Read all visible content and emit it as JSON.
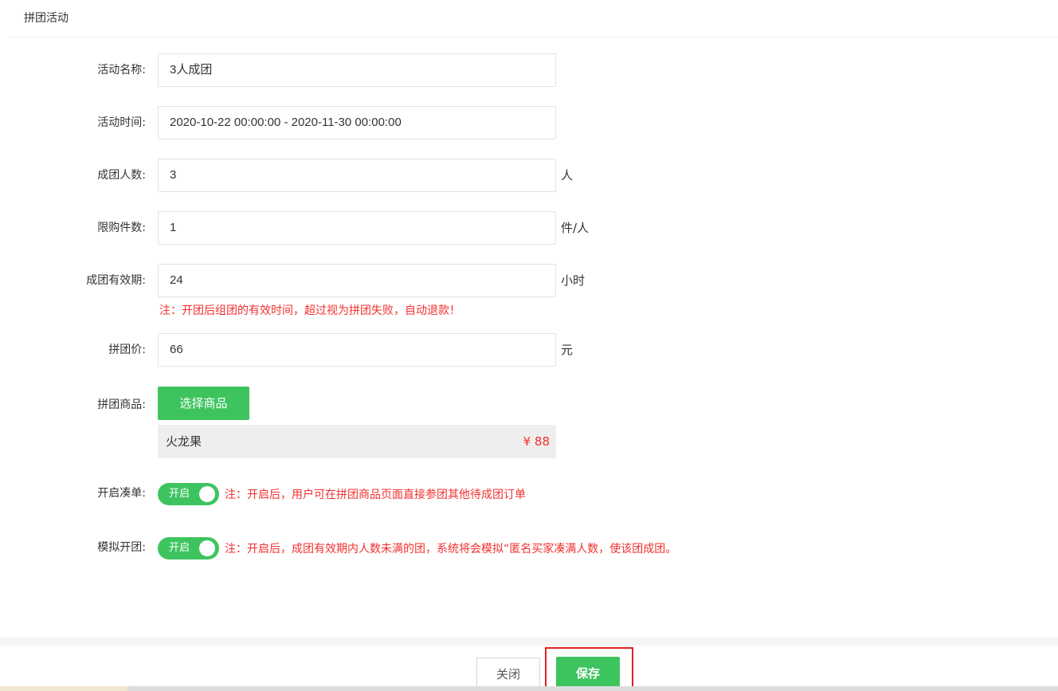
{
  "panel": {
    "title": "拼团活动"
  },
  "form": {
    "name": {
      "label": "活动名称:",
      "value": "3人成团"
    },
    "time": {
      "label": "活动时间:",
      "value": "2020-10-22 00:00:00 - 2020-11-30 00:00:00"
    },
    "group_size": {
      "label": "成团人数:",
      "value": "3",
      "unit": "人"
    },
    "limit": {
      "label": "限购件数:",
      "value": "1",
      "unit": "件/人"
    },
    "validity": {
      "label": "成团有效期:",
      "value": "24",
      "unit": "小时",
      "note": "注：开团后组团的有效时间，超过视为拼团失败，自动退款！"
    },
    "price": {
      "label": "拼团价:",
      "value": "66",
      "unit": "元"
    },
    "goods": {
      "label": "拼团商品:",
      "button": "选择商品",
      "item_name": "火龙果",
      "item_price": "¥ 88"
    },
    "fill_order": {
      "label": "开启凑单:",
      "switch_text": "开启",
      "enabled": true,
      "note": "注：开启后，用户可在拼团商品页面直接参团其他待成团订单"
    },
    "simulate": {
      "label": "模拟开团:",
      "switch_text": "开启",
      "enabled": true,
      "note": "注：开启后，成团有效期内人数未满的团，系统将会模拟“匿名买家凑满人数，使该团成团。"
    }
  },
  "footer": {
    "close_label": "关闭",
    "save_label": "保存"
  },
  "colors": {
    "accent_green": "#3ec45f",
    "note_red": "#f23030",
    "highlight_red": "#e02020"
  }
}
